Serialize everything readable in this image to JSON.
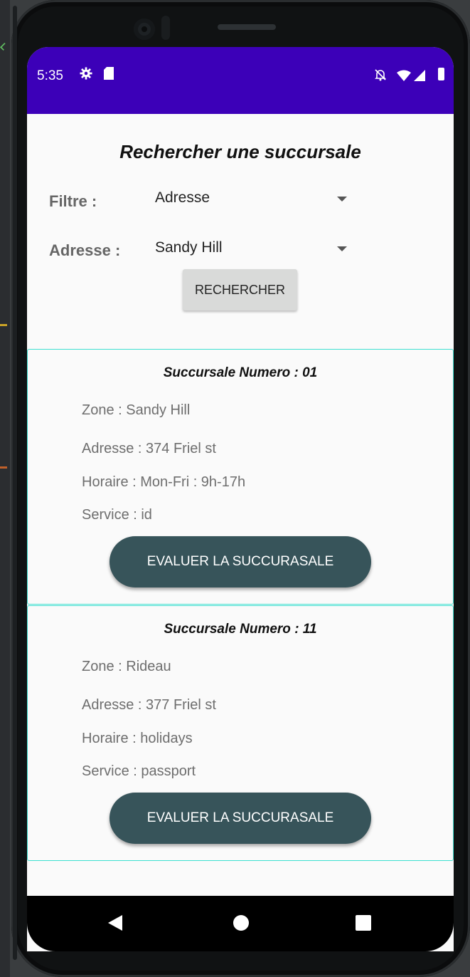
{
  "status_bar": {
    "time": "5:35",
    "icons": [
      "gear-icon",
      "sd-card-icon",
      "bell-off-icon",
      "wifi-icon",
      "signal-icon",
      "battery-icon"
    ],
    "color": "#3c00b8"
  },
  "page": {
    "title": "Rechercher une succursale"
  },
  "filters": {
    "filter_label": "Filtre :",
    "filter_value": "Adresse",
    "address_label": "Adresse :",
    "address_value": "Sandy Hill",
    "search_label": "RECHERCHER"
  },
  "results": [
    {
      "title": "Succursale Numero   :  01",
      "zone": "Zone :  Sandy Hill",
      "adresse": "Adresse :  374 Friel st",
      "horaire": "Horaire :  Mon-Fri : 9h-17h",
      "service": "Service  :  id",
      "button_label": "EVALUER LA SUCCURASALE"
    },
    {
      "title": "Succursale Numero   :  11",
      "zone": "Zone :  Rideau",
      "adresse": "Adresse :  377 Friel st",
      "horaire": "Horaire :  holidays",
      "service": "Service  :  passport",
      "button_label": "EVALUER LA SUCCURASALE"
    }
  ],
  "colors": {
    "accent": "#3c00b8",
    "button": "#37545a",
    "card_border": "#3de0d0"
  },
  "nav_bar": {
    "icons": [
      "back-icon",
      "home-icon",
      "recents-icon"
    ]
  }
}
